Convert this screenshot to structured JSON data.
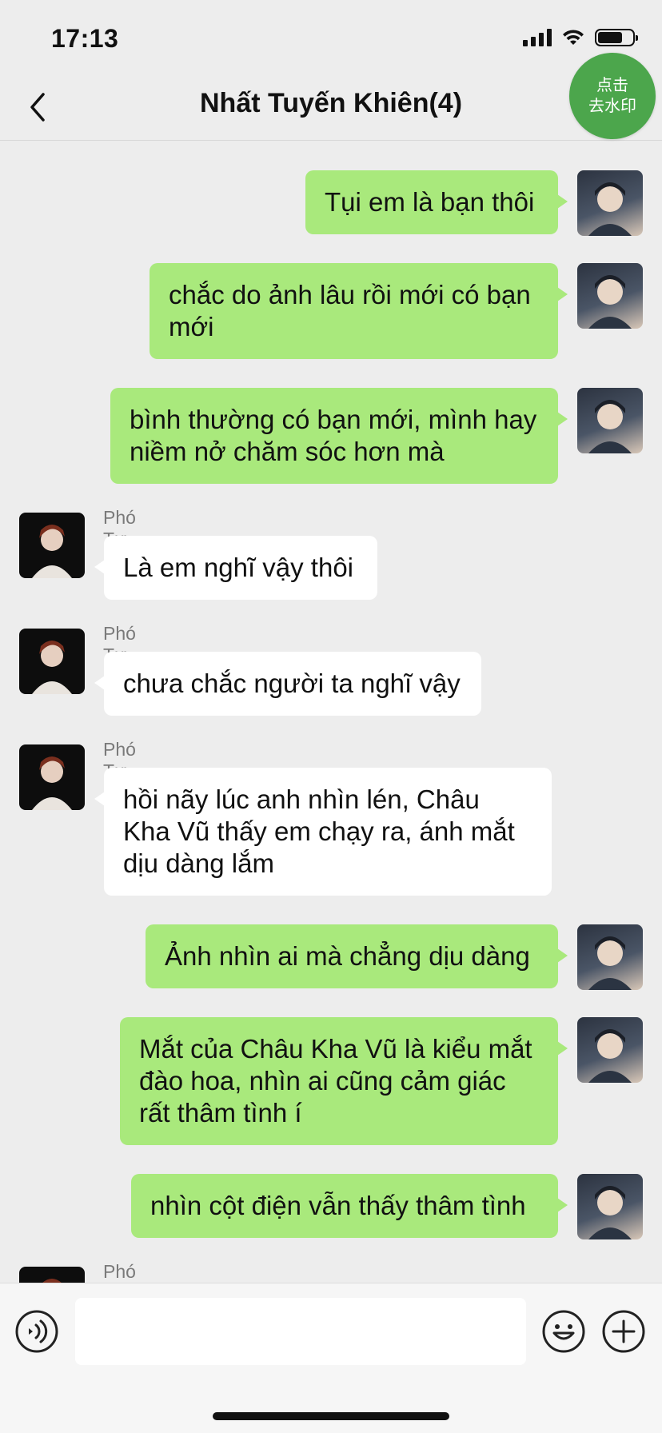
{
  "status_bar": {
    "time": "17:13",
    "battery_level": 0.72
  },
  "header": {
    "title": "Nhất Tuyến Khiên(4)",
    "back_icon": "chevron-left-icon"
  },
  "watermark_button": {
    "line1": "点击",
    "line2": "去水印",
    "color": "#4ca64c"
  },
  "messages": [
    {
      "sender": "self",
      "text": "Tụi em là bạn thôi"
    },
    {
      "sender": "self",
      "text": "chắc do ảnh lâu rồi mới có bạn mới"
    },
    {
      "sender": "self",
      "text": "bình thường có bạn mới, mình hay niềm nở chăm sóc hơn mà"
    },
    {
      "sender": "other",
      "name": "Phó Tư Siêu",
      "text": "Là em nghĩ vậy thôi"
    },
    {
      "sender": "other",
      "name": "Phó Tư Siêu",
      "text": "chưa chắc người ta nghĩ vậy"
    },
    {
      "sender": "other",
      "name": "Phó Tư Siêu",
      "text": "hồi nãy lúc anh nhìn lén, Châu Kha Vũ thấy em chạy ra, ánh mắt dịu dàng lắm"
    },
    {
      "sender": "self",
      "text": "Ảnh nhìn ai mà chẳng dịu dàng"
    },
    {
      "sender": "self",
      "text": "Mắt của Châu Kha Vũ là kiểu mắt đào hoa, nhìn ai cũng cảm giác rất thâm tình í"
    },
    {
      "sender": "self",
      "text": "nhìn cột điện vẫn thấy thâm tình"
    },
    {
      "sender": "other",
      "name": "Phó Tư Siêu",
      "text": ""
    }
  ],
  "input_bar": {
    "voice_icon": "voice-icon",
    "emoji_icon": "emoji-icon",
    "plus_icon": "plus-icon",
    "input_value": ""
  },
  "colors": {
    "self_bubble": "#a9e97c",
    "other_bubble": "#ffffff",
    "background": "#ededed"
  }
}
